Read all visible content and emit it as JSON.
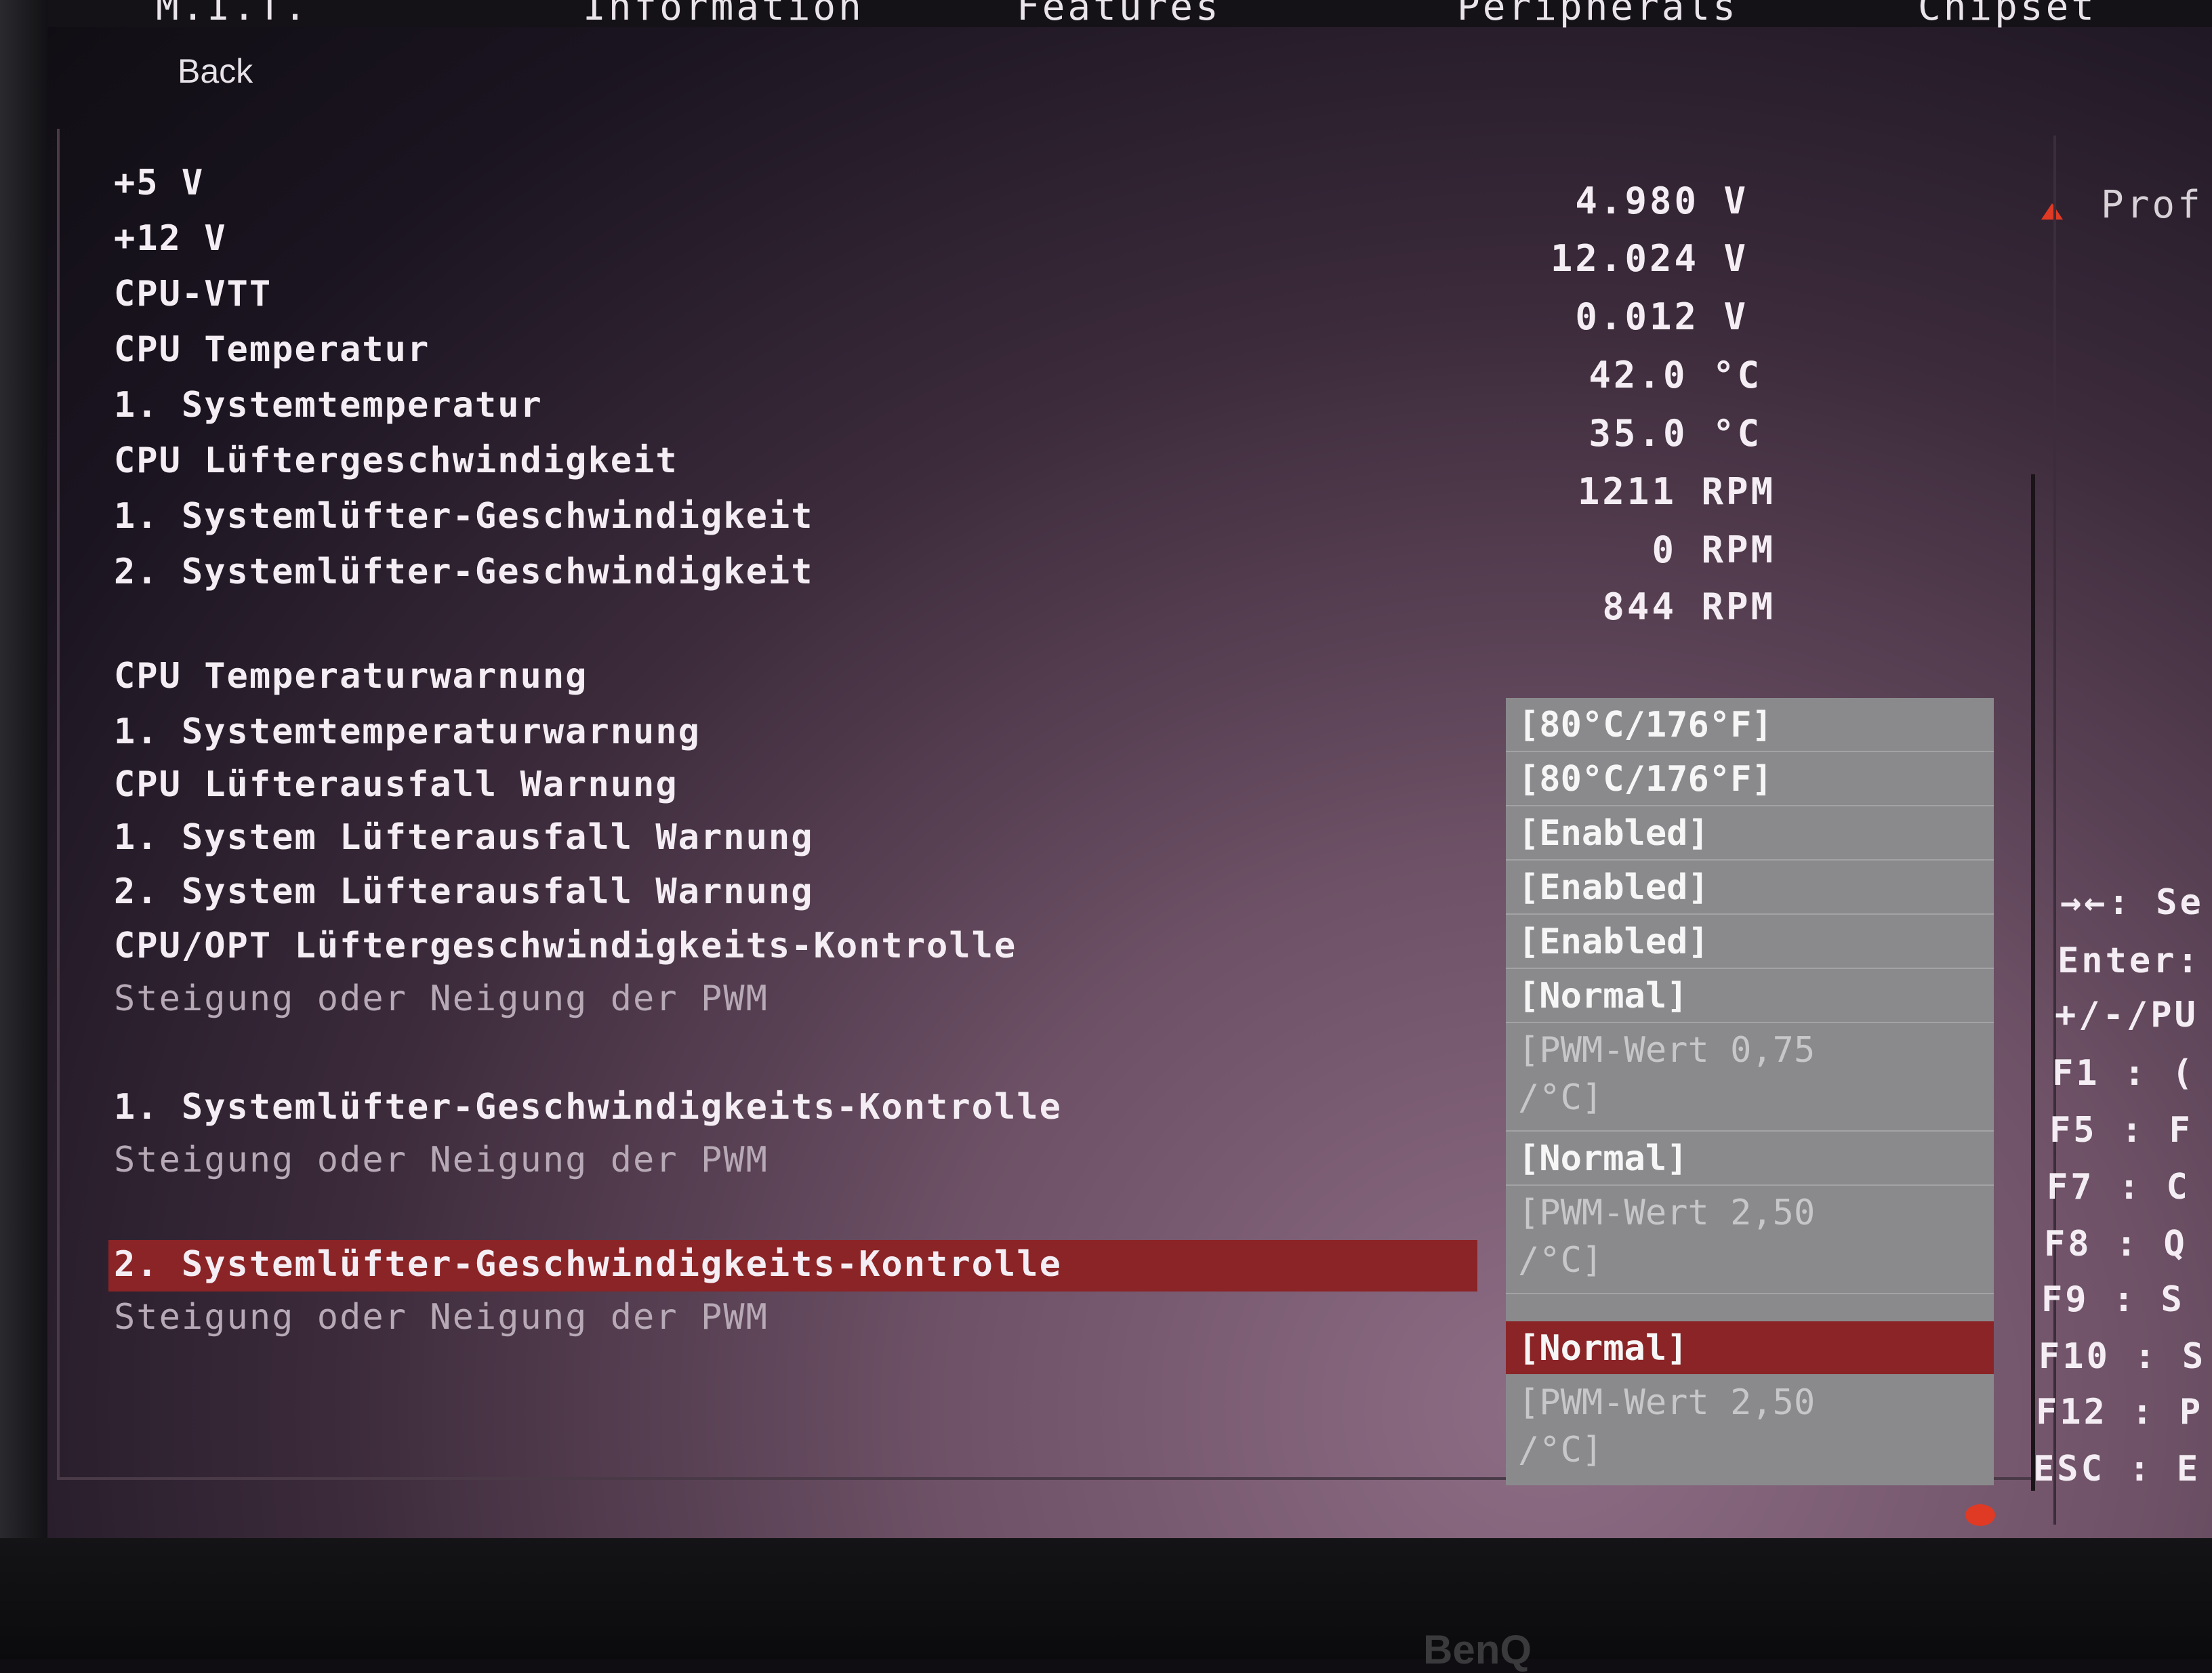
{
  "top_tabs": [
    "M.I.T.",
    "Information",
    "Features",
    "Peripherals",
    "Chipset"
  ],
  "back_label": "Back",
  "monitor": {
    "items": [
      {
        "label": "+5 V",
        "value": "4.980 V"
      },
      {
        "label": "+12 V",
        "value": "12.024 V"
      },
      {
        "label": "CPU-VTT",
        "value": "0.012 V"
      },
      {
        "label": "CPU Temperatur",
        "value": "42.0 °C"
      },
      {
        "label": "1. Systemtemperatur",
        "value": "35.0 °C"
      },
      {
        "label": "CPU Lüftergeschwindigkeit",
        "value": "1211 RPM"
      },
      {
        "label": "1. Systemlüfter-Geschwindigkeit",
        "value": "0 RPM"
      },
      {
        "label": "2. Systemlüfter-Geschwindigkeit",
        "value": "844 RPM"
      }
    ]
  },
  "settings": {
    "labels": [
      "CPU Temperaturwarnung",
      "1. Systemtemperaturwarnung",
      "CPU Lüfterausfall Warnung",
      "1. System Lüfterausfall Warnung",
      "2. System Lüfterausfall Warnung",
      "CPU/OPT Lüftergeschwindigkeits-Kontrolle",
      "Steigung oder Neigung der PWM",
      "1. Systemlüfter-Geschwindigkeits-Kontrolle",
      "Steigung oder Neigung der PWM",
      "2. Systemlüfter-Geschwindigkeits-Kontrolle",
      "Steigung oder Neigung der PWM"
    ],
    "options": [
      "[80°C/176°F]",
      "[80°C/176°F]",
      "[Enabled]",
      "[Enabled]",
      "[Enabled]",
      "[Normal]",
      "[PWM-Wert 0,75",
      "/°C]",
      "[Normal]",
      "[PWM-Wert 2,50",
      "/°C]",
      "[Normal]",
      "[PWM-Wert 2,50",
      "/°C]"
    ]
  },
  "right_panel": {
    "profile_label": "Prof",
    "help": [
      "→←: Se",
      "Enter:",
      "+/-/PU",
      "F1  : (",
      "F5  : F",
      "F7  : C",
      "F8  : Q",
      "F9  : S",
      "F10 : S",
      "F12 : P",
      "ESC : E"
    ]
  },
  "monitor_brand": "BenQ",
  "colors": {
    "highlight": "#8b2426",
    "option_bg": "#8a8a8c",
    "accent": "#e03a24"
  }
}
